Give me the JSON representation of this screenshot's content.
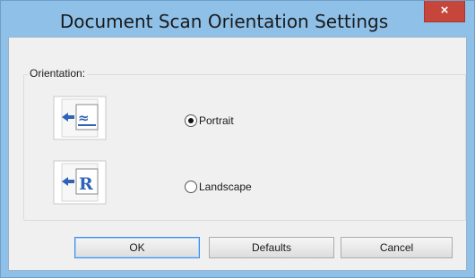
{
  "window": {
    "title": "Document Scan Orientation Settings",
    "close_glyph": "×"
  },
  "group": {
    "label": "Orientation:"
  },
  "options": [
    {
      "label": "Portrait",
      "icon": "portrait-orientation-icon",
      "checked": true
    },
    {
      "label": "Landscape",
      "icon": "landscape-orientation-icon",
      "checked": false
    }
  ],
  "buttons": {
    "ok": "OK",
    "defaults": "Defaults",
    "cancel": "Cancel"
  },
  "colors": {
    "titlebar": "#8fc0e8",
    "close": "#c7463c",
    "client": "#f0f0f0",
    "icon_blue": "#2f63b6"
  }
}
